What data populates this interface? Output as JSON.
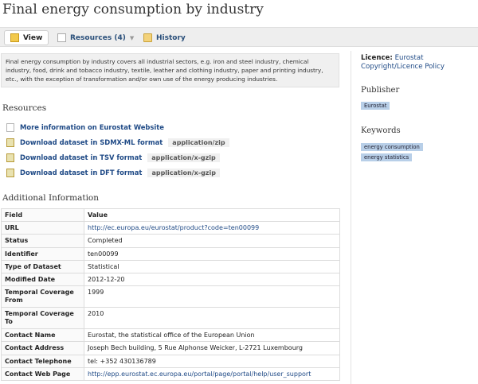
{
  "page": {
    "title": "Final energy consumption by industry"
  },
  "tabs": {
    "view": "View",
    "resources": "Resources (4)",
    "history": "History"
  },
  "description": "Final energy consumption by industry covers all industrial sectors, e.g. iron and steel industry, chemical industry, food, drink and tobacco industry, textile, leather and clothing industry, paper and printing industry, etc., with the exception of transformation and/or own use of the energy producing industries.",
  "resources": {
    "heading": "Resources",
    "items": [
      {
        "label": "More information on Eurostat Website",
        "format": "",
        "icon": "page-icon"
      },
      {
        "label": "Download dataset in SDMX-ML format",
        "format": "application/zip",
        "icon": "data-icon"
      },
      {
        "label": "Download dataset in TSV format",
        "format": "application/x-gzip",
        "icon": "data-icon"
      },
      {
        "label": "Download dataset in DFT format",
        "format": "application/x-gzip",
        "icon": "data-icon"
      }
    ]
  },
  "additional_info": {
    "heading": "Additional Information",
    "columns": [
      "Field",
      "Value"
    ],
    "rows": [
      {
        "field": "URL",
        "value": "http://ec.europa.eu/eurostat/product?code=ten00099",
        "link": true
      },
      {
        "field": "Status",
        "value": "Completed"
      },
      {
        "field": "Identifier",
        "value": "ten00099"
      },
      {
        "field": "Type of Dataset",
        "value": "Statistical"
      },
      {
        "field": "Modified Date",
        "value": "2012-12-20"
      },
      {
        "field": "Temporal Coverage From",
        "value": "1999"
      },
      {
        "field": "Temporal Coverage To",
        "value": "2010"
      },
      {
        "field": "Contact Name",
        "value": "Eurostat, the statistical office of the European Union"
      },
      {
        "field": "Contact Address",
        "value": "Joseph Bech building, 5 Rue Alphonse Weicker, L-2721 Luxembourg"
      },
      {
        "field": "Contact Telephone",
        "value": "tel: +352 430136789"
      },
      {
        "field": "Contact Web Page",
        "value": "http://epp.eurostat.ec.europa.eu/portal/page/portal/help/user_support",
        "link": true
      }
    ]
  },
  "sidebar": {
    "licence_label": "Licence:",
    "licence_value": "Eurostat",
    "licence_link": "Copyright/Licence Policy",
    "publisher_heading": "Publisher",
    "publisher": "Eurostat",
    "keywords_heading": "Keywords",
    "keywords": [
      "energy consumption",
      "energy statistics"
    ]
  }
}
